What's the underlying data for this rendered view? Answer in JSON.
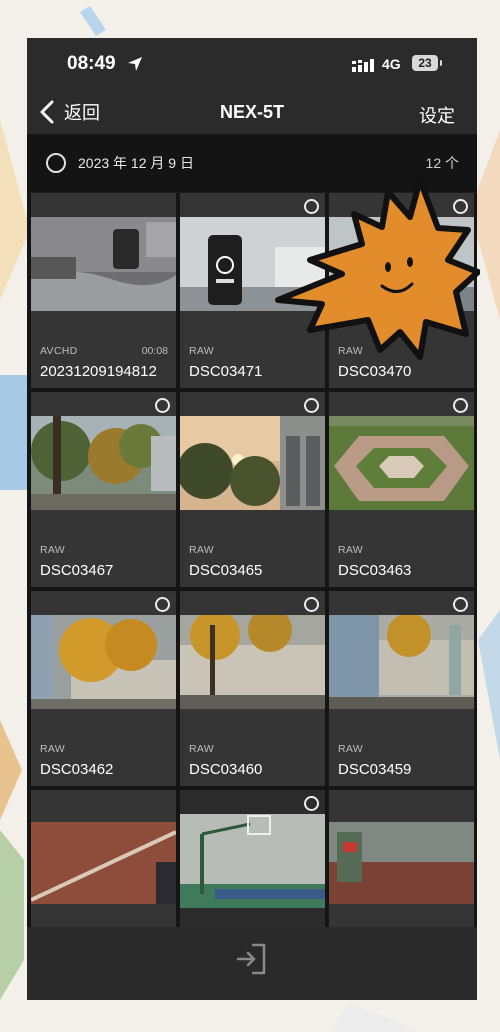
{
  "status_bar": {
    "time": "08:49",
    "network": "4G",
    "battery": "23"
  },
  "nav": {
    "back_label": "返回",
    "title": "NEX-5T",
    "settings_label": "设定"
  },
  "group": {
    "date": "2023 年 12 月 9 日",
    "count": "12 个"
  },
  "photos": [
    {
      "format": "AVCHD",
      "duration": "00:08",
      "name": "20231209194812",
      "selectable": false
    },
    {
      "format": "RAW",
      "duration": "",
      "name": "DSC03471",
      "selectable": true
    },
    {
      "format": "RAW",
      "duration": "",
      "name": "DSC03470",
      "selectable": true
    },
    {
      "format": "RAW",
      "duration": "",
      "name": "DSC03467",
      "selectable": true
    },
    {
      "format": "RAW",
      "duration": "",
      "name": "DSC03465",
      "selectable": true
    },
    {
      "format": "RAW",
      "duration": "",
      "name": "DSC03463",
      "selectable": true
    },
    {
      "format": "RAW",
      "duration": "",
      "name": "DSC03462",
      "selectable": true
    },
    {
      "format": "RAW",
      "duration": "",
      "name": "DSC03460",
      "selectable": true
    },
    {
      "format": "RAW",
      "duration": "",
      "name": "DSC03459",
      "selectable": true
    },
    {
      "format": "",
      "duration": "",
      "name": "",
      "selectable": false
    },
    {
      "format": "",
      "duration": "",
      "name": "",
      "selectable": true
    },
    {
      "format": "",
      "duration": "",
      "name": "",
      "selectable": false
    }
  ],
  "icons": {
    "back": "chevron-left-icon",
    "location": "location-arrow-icon",
    "signal": "cellular-signal-icon",
    "select": "radio-circle-icon",
    "export": "import-arrow-icon"
  },
  "colors": {
    "background": "#1c1c1e",
    "tile": "#353535",
    "accent": "#e8902a"
  }
}
